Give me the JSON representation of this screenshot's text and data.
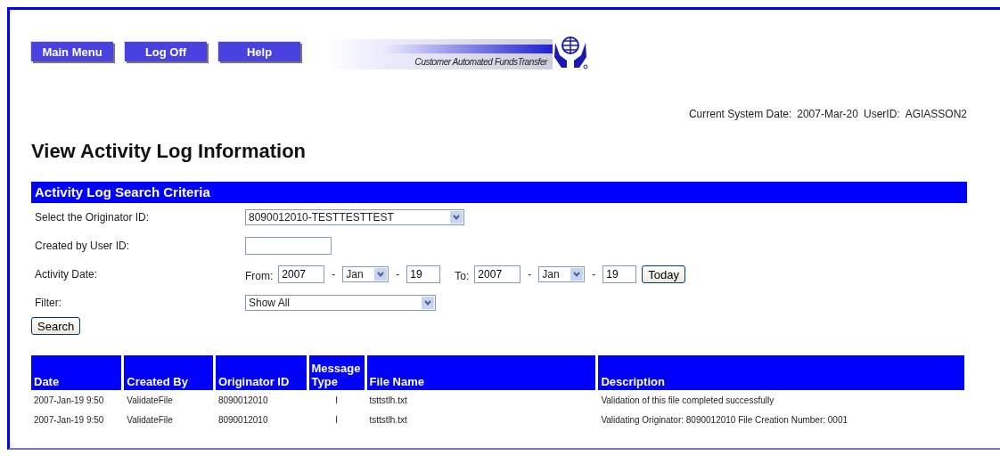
{
  "nav_buttons": [
    "Main Menu",
    "Log Off",
    "Help"
  ],
  "logo": {
    "text": "Customer Automated FundsTransfer"
  },
  "session": {
    "date_label": "Current System Date:",
    "date": "2007-Mar-20",
    "user_label": "UserID:",
    "user": "AGIASSON2"
  },
  "page_title": "View Activity Log Information",
  "search_panel": {
    "title": "Activity Log Search Criteria",
    "originator": {
      "label": "Select the Originator ID:",
      "value": "8090012010-TESTTESTTEST"
    },
    "user_id": {
      "label": "Created by User ID:"
    },
    "activity_date": {
      "label": "Activity Date:",
      "from_label": "From:",
      "from": {
        "year": "2007",
        "month": "Jan",
        "day": "19"
      },
      "to_label": "To:",
      "to": {
        "year": "2007",
        "month": "Jan",
        "day": "19"
      },
      "separator": "-",
      "today_button": "Today"
    },
    "filter": {
      "label": "Filter:",
      "value": "Show All"
    },
    "search_button": "Search"
  },
  "table": {
    "columns": [
      "Date",
      "Created By",
      "Originator ID",
      "Message Type",
      "File Name",
      "Description"
    ],
    "rows": [
      [
        "2007-Jan-19 9:50",
        "ValidateFile",
        "8090012010",
        "I",
        "tsttstlh.txt",
        "Validation of this file completed successfully"
      ],
      [
        "2007-Jan-19 9:50",
        "ValidateFile",
        "8090012010",
        "I",
        "tsttstlh.txt",
        "Validating Originator: 8090012010 File Creation Number: 0001"
      ]
    ]
  }
}
